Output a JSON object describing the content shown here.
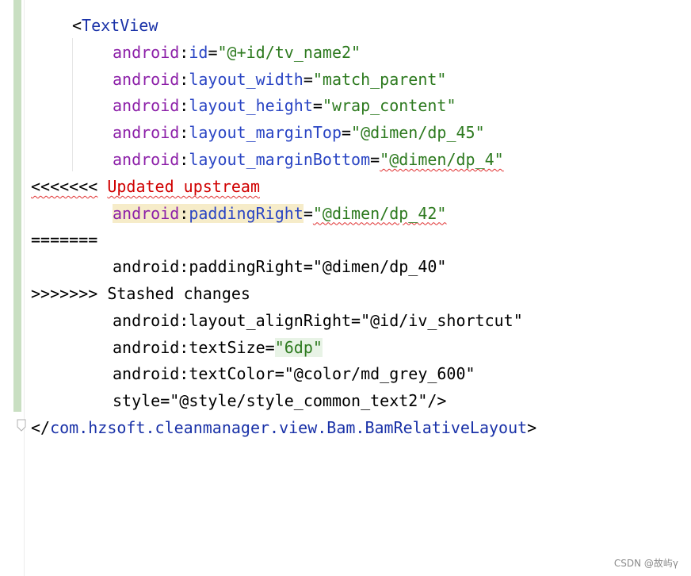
{
  "code": {
    "open_bracket": "<",
    "open_tag": "TextView",
    "ns": "android",
    "colon": ":",
    "eq": "=",
    "attrs": [
      {
        "name": "id",
        "value": "\"@+id/tv_name2\""
      },
      {
        "name": "layout_width",
        "value": "\"match_parent\""
      },
      {
        "name": "layout_height",
        "value": "\"wrap_content\""
      },
      {
        "name": "layout_marginTop",
        "value": "\"@dimen/dp_45\""
      },
      {
        "name": "layout_marginBottom",
        "value": "\"@dimen/dp_4\""
      }
    ],
    "conflict_start_marker": "<<<<<<<",
    "conflict_start_label": "Updated upstream",
    "upstream_attr": {
      "name": "paddingRight",
      "value": "\"@dimen/dp_42\""
    },
    "separator": "=======",
    "stashed_line": "android:paddingRight=\"@dimen/dp_40\"",
    "conflict_end": ">>>>>>> Stashed changes",
    "plain_lines": [
      "android:layout_alignRight=\"@id/iv_shortcut\"",
      "android:textColor=\"@color/md_grey_600\"",
      "style=\"@style/style_common_text2\"/>"
    ],
    "text_size_prefix": "android:textSize=",
    "text_size_value": "\"6dp\"",
    "close_open": "</",
    "close_tag": "com.hzsoft.cleanmanager.view.Bam.BamRelativeLayout",
    "close_end": ">"
  },
  "watermark": "CSDN @故屿γ",
  "colors": {
    "change_bar": "#c9dfc2",
    "tag": "#1a32a8",
    "namespace": "#8c1fa8",
    "attribute": "#2a45c4",
    "value": "#2d7a1f",
    "conflict": "#d00000"
  }
}
